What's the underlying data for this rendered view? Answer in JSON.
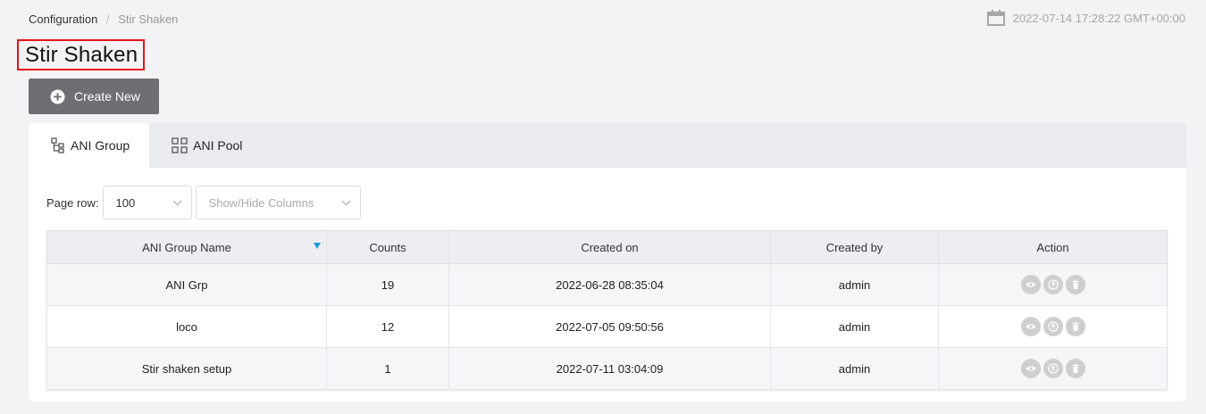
{
  "breadcrumb": {
    "root": "Configuration",
    "separator": "/",
    "current": "Stir Shaken"
  },
  "datetime": "2022-07-14 17:28:22 GMT+00:00",
  "page_title": "Stir Shaken",
  "create_button": "Create New",
  "tabs": [
    {
      "label": "ANI Group",
      "icon": "ani-group-icon",
      "active": true
    },
    {
      "label": "ANI Pool",
      "icon": "ani-pool-icon",
      "active": false
    }
  ],
  "toolbar": {
    "page_row_label": "Page row:",
    "page_row_value": "100",
    "columns_placeholder": "Show/Hide Columns"
  },
  "table": {
    "headers": [
      "ANI Group Name",
      "Counts",
      "Created on",
      "Created by",
      "Action"
    ],
    "rows": [
      {
        "name": "ANI Grp",
        "counts": "19",
        "created_on": "2022-06-28 08:35:04",
        "created_by": "admin"
      },
      {
        "name": "loco",
        "counts": "12",
        "created_on": "2022-07-05 09:50:56",
        "created_by": "admin"
      },
      {
        "name": "Stir shaken setup",
        "counts": "1",
        "created_on": "2022-07-11 03:04:09",
        "created_by": "admin"
      }
    ],
    "action_icons": [
      "eye-icon",
      "upload-icon",
      "trash-icon"
    ]
  },
  "colors": {
    "title_border": "#e8131b",
    "create_button_bg": "#6d6f72",
    "sort_indicator": "#1a9bdc",
    "action_icon_bg": "#cfcfcf"
  }
}
